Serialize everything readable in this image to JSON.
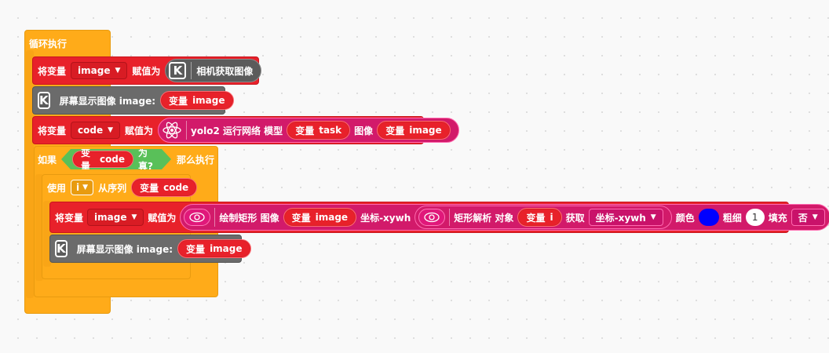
{
  "loop": {
    "label": "循环执行"
  },
  "block1": {
    "set_label": "将变量",
    "var": "image",
    "assign_label": "赋值为",
    "reporter": {
      "icon": "k-logo-icon",
      "icon_text": "K",
      "text": "相机获取图像"
    }
  },
  "block2": {
    "icon_text": "K",
    "text": "屏幕显示图像 image:",
    "arg": {
      "prefix": "变量",
      "name": "image"
    }
  },
  "block3": {
    "set_label": "将变量",
    "var": "code",
    "assign_label": "赋值为",
    "reporter": {
      "icon": "atom-icon",
      "text1": "yolo2 运行网络 模型",
      "arg1": {
        "prefix": "变量",
        "name": "task"
      },
      "text2": "图像",
      "arg2": {
        "prefix": "变量",
        "name": "image"
      }
    }
  },
  "if_block": {
    "if_label": "如果",
    "cond": {
      "prefix": "变量",
      "name": "code",
      "suffix": "为真?"
    },
    "then_label": "那么执行"
  },
  "for_block": {
    "use_label": "使用",
    "var": "i",
    "from_label": "从序列",
    "seq": {
      "prefix": "变量",
      "name": "code"
    }
  },
  "block4": {
    "set_label": "将变量",
    "var": "image",
    "assign_label": "赋值为",
    "draw": {
      "icon": "eye-icon",
      "text": "绘制矩形 图像",
      "img_arg": {
        "prefix": "变量",
        "name": "image"
      },
      "coord_label": "坐标-xywh"
    },
    "parse": {
      "icon": "eye-icon",
      "text": "矩形解析 对象",
      "obj_arg": {
        "prefix": "变量",
        "name": "i"
      },
      "get_label": "获取",
      "field": "坐标-xywh"
    },
    "color_label": "颜色",
    "color": "#0000ff",
    "thick_label": "粗细",
    "thick": "1",
    "fill_label": "填充",
    "fill": "否"
  },
  "block5": {
    "icon_text": "K",
    "text": "屏幕显示图像 image:",
    "arg": {
      "prefix": "变量",
      "name": "image"
    }
  },
  "colors": {
    "control": "#ffab19",
    "variable": "#e8212a",
    "display": "#6b6b6b",
    "ai": "#d21a6a",
    "operator": "#59c059"
  }
}
